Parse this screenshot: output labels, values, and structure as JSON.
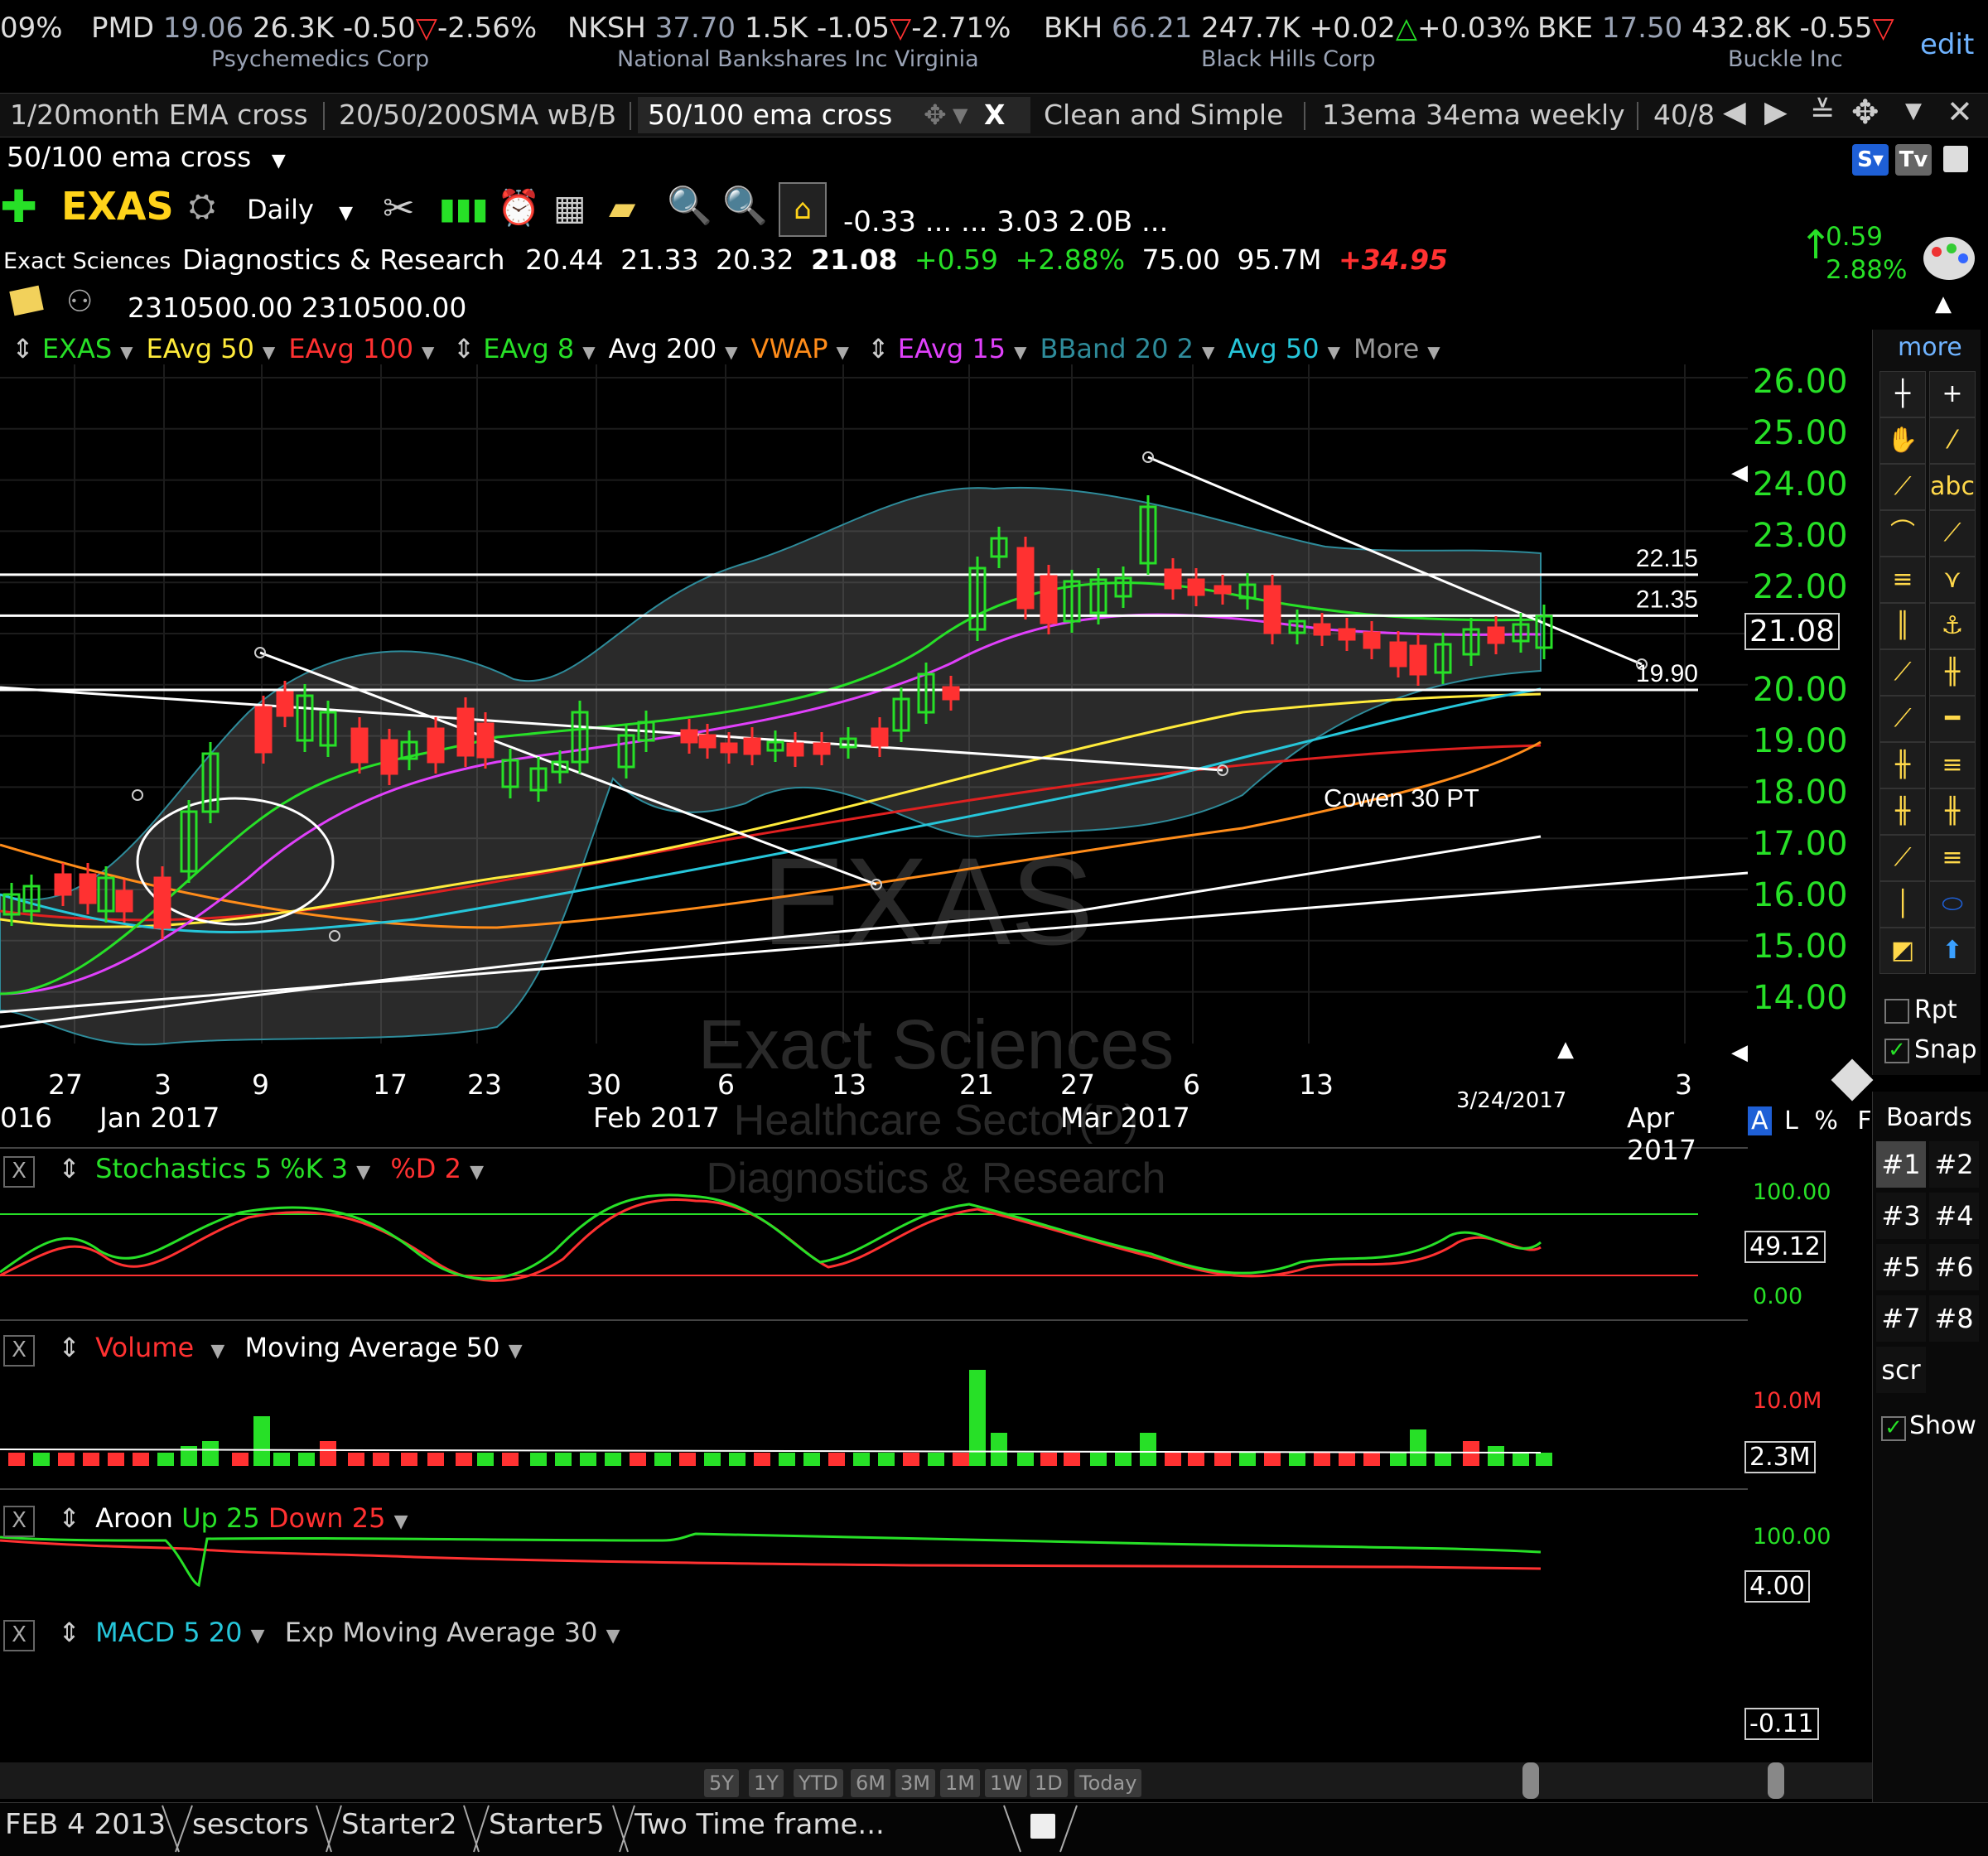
{
  "ticker": [
    {
      "text_a": "09%",
      "text_b": "",
      "company": ""
    },
    {
      "sym": "PMD",
      "price": "19.06",
      "vol": "26.3K",
      "chg": "-0.50",
      "pct": "-2.56%",
      "company": "Psychemedics Corp",
      "dir": "down"
    },
    {
      "sym": "NKSH",
      "price": "37.70",
      "vol": "1.5K",
      "chg": "-1.05",
      "pct": "-2.71%",
      "company": "National Bankshares Inc Virginia",
      "dir": "down"
    },
    {
      "sym": "BKH",
      "price": "66.21",
      "vol": "247.7K",
      "chg": "+0.02",
      "pct": "+0.03%",
      "company": "Black Hills Corp",
      "dir": "up"
    },
    {
      "sym": "BKE",
      "price": "17.50",
      "vol": "432.8K",
      "chg": "-0.55",
      "pct": "",
      "company": "Buckle Inc",
      "dir": "down"
    }
  ],
  "ticker_edit": "edit",
  "tabs": [
    "1/20month EMA cross",
    "20/50/200SMA wB/B",
    "50/100 ema cross",
    "Clean and Simple",
    "13ema 34ema weekly",
    "40/8"
  ],
  "active_tab_close": "X",
  "layout_name": "50/100 ema cross",
  "symbol": "EXAS",
  "interval": "Daily",
  "quote_extra": "-0.33  ...  ...  3.03  2.0B  ...",
  "company": {
    "short": "Exact Sciences",
    "industry": "Diagnostics & Research",
    "open": "20.44",
    "high": "21.33",
    "low": "20.32",
    "last": "21.08",
    "chg": "+0.59",
    "pct": "+2.88%",
    "v1": "75.00",
    "v2": "95.7M",
    "v3": "+34.95"
  },
  "change_box": {
    "chg": "0.59",
    "pct": "2.88%"
  },
  "note_values": "2310500.00  2310500.00",
  "indicators": [
    {
      "label": "EXAS",
      "color": "#27e027"
    },
    {
      "label": "EAvg 50",
      "color": "#ffeb3b"
    },
    {
      "label": "EAvg 100",
      "color": "#ff3131"
    },
    {
      "label": "EAvg 8",
      "color": "#27e027"
    },
    {
      "label": "Avg 200",
      "color": "#ffffff"
    },
    {
      "label": "VWAP",
      "color": "#ff8c1a"
    },
    {
      "label": "EAvg 15",
      "color": "#e040fb"
    },
    {
      "label": "BBand 20 2",
      "color": "#2e8b9a"
    },
    {
      "label": "Avg 50",
      "color": "#26c6da"
    },
    {
      "label": "More",
      "color": "#999999"
    }
  ],
  "price_axis": [
    "26.00",
    "25.00",
    "24.00",
    "23.00",
    "22.00",
    "21.08",
    "20.00",
    "19.00",
    "18.00",
    "17.00",
    "16.00",
    "15.00",
    "14.00"
  ],
  "levels": [
    "22.15",
    "21.35",
    "19.90"
  ],
  "annotation": "Cowen 30 PT",
  "watermark": {
    "symbol": "EXAS",
    "name": "Exact Sciences",
    "sector": "Healthcare Sector(D)",
    "industry": "Diagnostics & Research"
  },
  "date_axis_days": [
    "27",
    "3",
    "9",
    "17",
    "23",
    "30",
    "6",
    "13",
    "21",
    "27",
    "6",
    "13",
    "3"
  ],
  "date_axis_months": [
    "016",
    "Jan 2017",
    "Feb 2017",
    "Mar 2017",
    "Apr 2017"
  ],
  "date_marker": "3/24/2017",
  "axis_mode": [
    "A",
    "L",
    "%",
    "F"
  ],
  "more_label": "more",
  "rpt_label": "Rpt",
  "snap_label": "Snap",
  "boards_title": "Boards",
  "boards": [
    "#1",
    "#2",
    "#3",
    "#4",
    "#5",
    "#6",
    "#7",
    "#8"
  ],
  "scr_label": "scr",
  "show_label": "Show",
  "panels": {
    "stoch": {
      "name": "Stochastics 5 %K 3",
      "d": "%D 2",
      "max": "100.00",
      "min": "0.00",
      "val": "49.12"
    },
    "volume": {
      "name": "Volume",
      "ma": "Moving Average 50",
      "max": "10.0M",
      "val": "2.3M"
    },
    "aroon": {
      "name": "Aroon",
      "up": "Up 25",
      "down": "Down 25",
      "max": "100.00",
      "val": "4.00"
    },
    "macd": {
      "name": "MACD 5 20",
      "ema": "Exp Moving Average 30",
      "val": "-0.11"
    }
  },
  "range_buttons": [
    "5Y",
    "1Y",
    "YTD",
    "6M",
    "3M",
    "1M",
    "1W",
    "1D",
    "Today"
  ],
  "bottom_tabs": [
    "FEB 4 2013",
    "sesctors",
    "Starter2",
    "Starter5",
    "Two Time frame..."
  ],
  "colors": {
    "up": "#27e027",
    "down": "#ff3131",
    "ema50": "#ffeb3b",
    "ema100": "#e02020",
    "ema8": "#27e027",
    "ema15": "#e040fb",
    "avg50": "#26c6da",
    "bband": "#2e8b9a",
    "vwap": "#ff8c1a"
  }
}
